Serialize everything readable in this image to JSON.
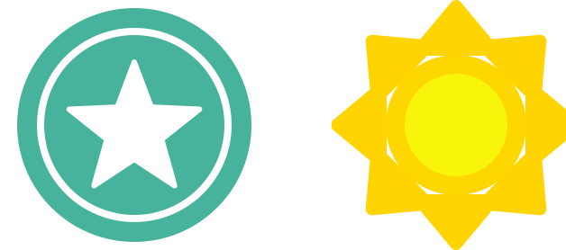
{
  "icons": [
    {
      "name": "star-badge-icon",
      "colors": {
        "ring": "#48b39c",
        "inner_ring_gap": "#ffffff",
        "star": "#ffffff"
      }
    },
    {
      "name": "sun-icon",
      "colors": {
        "rays": "#ffd400",
        "outer_disc": "#ffd700",
        "inner_disc": "#f8f40a"
      }
    }
  ]
}
